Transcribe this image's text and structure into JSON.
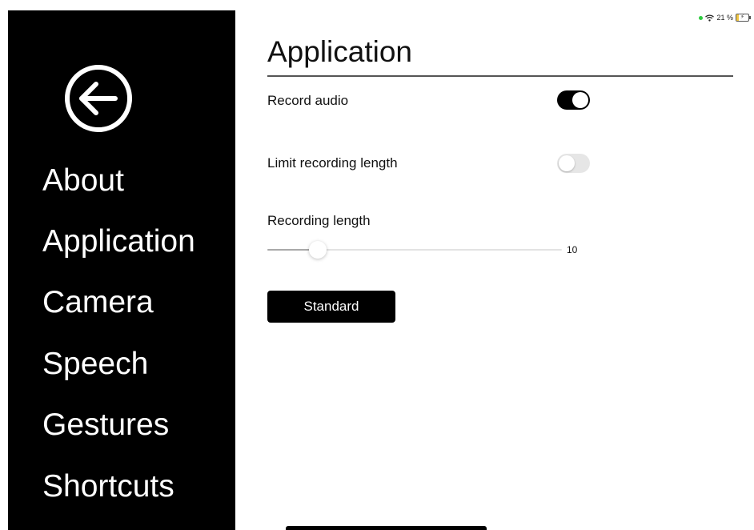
{
  "status_bar": {
    "battery_percent": "21 %",
    "icons": [
      "green-dot-icon",
      "wifi-icon",
      "battery-charging-icon"
    ],
    "colors": {
      "dot": "#2ecc40",
      "battery_fill": "#f2c744"
    }
  },
  "sidebar": {
    "back_icon": "back-arrow-circle-icon",
    "items": [
      {
        "label": "About"
      },
      {
        "label": "Application"
      },
      {
        "label": "Camera"
      },
      {
        "label": "Speech"
      },
      {
        "label": "Gestures"
      },
      {
        "label": "Shortcuts"
      }
    ],
    "background": "#000000",
    "text_color": "#ffffff"
  },
  "main": {
    "title": "Application",
    "settings": {
      "record_audio": {
        "label": "Record audio",
        "enabled": true
      },
      "limit_recording_length": {
        "label": "Limit recording length",
        "enabled": false
      },
      "recording_length": {
        "label": "Recording length",
        "value": "10",
        "fraction": 0.17
      }
    },
    "standard_button": {
      "label": "Standard"
    }
  }
}
